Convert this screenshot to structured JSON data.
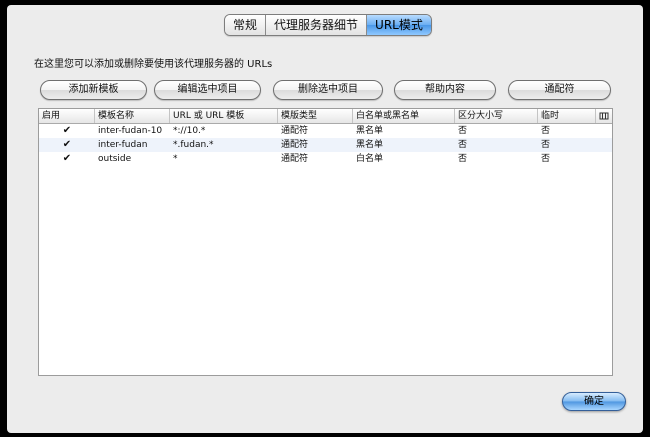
{
  "tabs": [
    "常规",
    "代理服务器细节",
    "URL模式"
  ],
  "active_tab": 2,
  "description": "在这里您可以添加或删除要使用该代理服务器的 URLs",
  "buttons": {
    "add": "添加新模板",
    "edit": "编辑选中项目",
    "delete": "删除选中项目",
    "help": "帮助内容",
    "wildcard": "通配符"
  },
  "table": {
    "columns": [
      "启用",
      "模板名称",
      "URL 或 URL 模板",
      "模版类型",
      "白名单或黑名单",
      "区分大小写",
      "临时"
    ],
    "column_picker_icon": "column-picker-icon",
    "rows": [
      {
        "enabled": "✔",
        "name": "inter-fudan-10",
        "url": "*://10.*",
        "type": "通配符",
        "list": "黑名单",
        "case_sensitive": "否",
        "temporary": "否"
      },
      {
        "enabled": "✔",
        "name": "inter-fudan",
        "url": "*.fudan.*",
        "type": "通配符",
        "list": "黑名单",
        "case_sensitive": "否",
        "temporary": "否"
      },
      {
        "enabled": "✔",
        "name": "outside",
        "url": "*",
        "type": "通配符",
        "list": "白名单",
        "case_sensitive": "否",
        "temporary": "否"
      }
    ]
  },
  "ok_button": "确定"
}
